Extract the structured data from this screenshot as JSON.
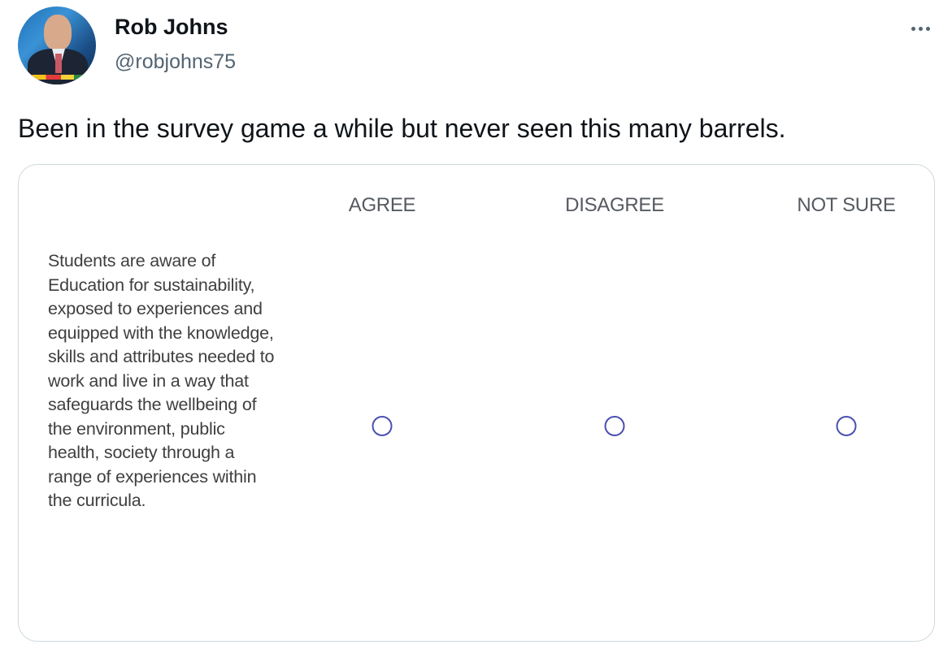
{
  "tweet": {
    "author_name": "Rob Johns",
    "author_handle": "@robjohns75",
    "avatar_icon": "user-avatar-photo",
    "more_icon": "more-horizontal-icon",
    "text": "Been in the survey game a while but never seen this many barrels."
  },
  "survey": {
    "columns": [
      "AGREE",
      "DISAGREE",
      "NOT SURE"
    ],
    "question": "Students are aware of Education for sustainability, exposed to experiences and equipped with the knowledge, skills and attributes needed to work and live in a way that safeguards the wellbeing of the environment, public health, society through a range of experiences within the curricula.",
    "selected": null,
    "radio_color": "#4a4fb0"
  }
}
